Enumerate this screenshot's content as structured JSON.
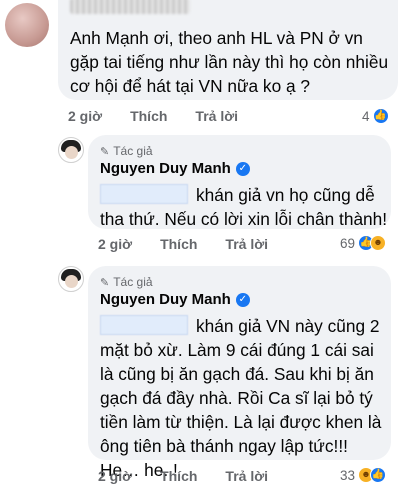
{
  "top_comment": {
    "text": "Anh Mạnh ơi, theo anh HL và PN ở vn gặp tai tiếng như lần này thì họ còn nhiều cơ hội để hát tại VN nữa ko ạ ?",
    "time": "2 giờ",
    "like_label": "Thích",
    "reply_label": "Trả lời",
    "reaction_count": "4",
    "reaction_icons": [
      "like-icon"
    ]
  },
  "replies": [
    {
      "badge": "Tác giả",
      "author": "Nguyen Duy Manh",
      "text": "khán giả vn họ cũng dễ tha thứ. Nếu có lời xin lỗi chân thành!",
      "time": "2 giờ",
      "like_label": "Thích",
      "reply_label": "Trả lời",
      "reaction_count": "69",
      "reaction_icons": [
        "like-icon",
        "haha-icon"
      ]
    },
    {
      "badge": "Tác giả",
      "author": "Nguyen Duy Manh",
      "text": "khán giả VN này cũng 2 mặt bỏ xừ. Làm 9 cái đúng 1 cái sai là cũng bị ăn gạch đá. Sau khi bị ăn gạch đá đầy nhà. Rồi Ca sĩ lại bỏ tý tiền làm từ thiện. Là lại được khen là ông tiên bà thánh ngay lập tức!!! He… he..!",
      "time": "2 giờ",
      "like_label": "Thích",
      "reply_label": "Trả lời",
      "reaction_count": "33",
      "reaction_icons": [
        "haha-icon",
        "like-icon"
      ]
    }
  ],
  "colors": {
    "bubble_bg": "#f0f2f5",
    "meta_text": "#65676b",
    "verified": "#1877f2"
  }
}
